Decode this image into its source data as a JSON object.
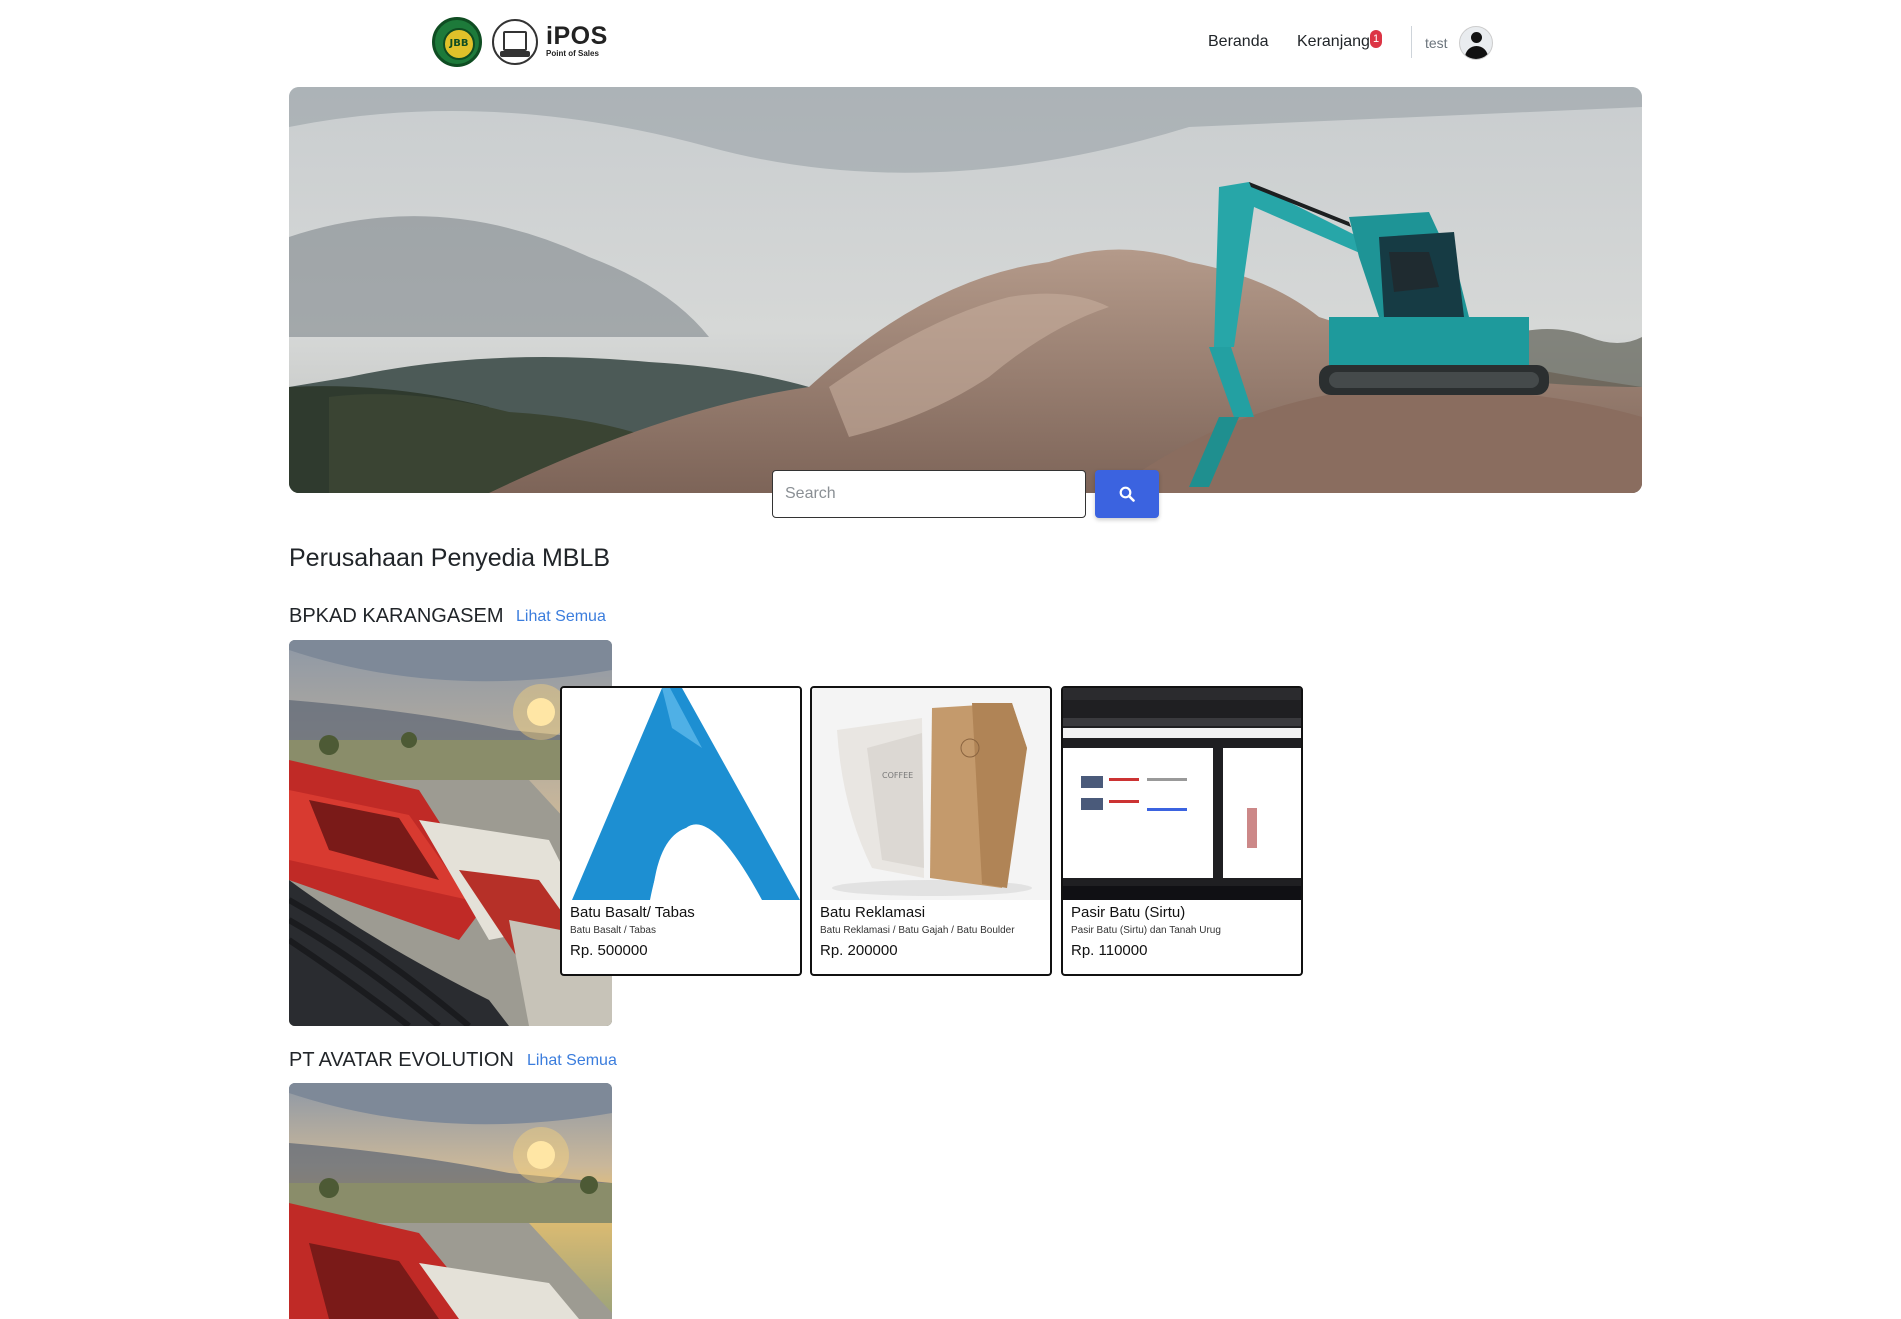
{
  "navbar": {
    "logo_badge_text": "JBB",
    "brand": "iPOS",
    "brand_sub": "Point of Sales",
    "links": [
      {
        "label": "Beranda"
      },
      {
        "label": "Keranjang",
        "badge": "1"
      }
    ],
    "user": "test"
  },
  "search": {
    "placeholder": "Search"
  },
  "section_title": "Perusahaan Penyedia MBLB",
  "companies": [
    {
      "name": "BPKAD KARANGASEM",
      "link": "Lihat Semua",
      "products": [
        {
          "name": "Batu Basalt/ Tabas",
          "desc": "Batu Basalt / Tabas",
          "price": "Rp. 500000"
        },
        {
          "name": "Batu Reklamasi",
          "desc": "Batu Reklamasi / Batu Gajah / Batu Boulder",
          "price": "Rp. 200000"
        },
        {
          "name": "Pasir Batu (Sirtu)",
          "desc": "Pasir Batu (Sirtu) dan Tanah Urug",
          "price": "Rp. 110000"
        }
      ]
    },
    {
      "name": "PT AVATAR EVOLUTION",
      "link": "Lihat Semua",
      "products": []
    }
  ],
  "colors": {
    "accent": "#3b63e0",
    "link": "#3b7ddd",
    "badge": "#dc3545"
  },
  "icons": {
    "search": "search-icon",
    "user": "user-avatar-icon"
  }
}
